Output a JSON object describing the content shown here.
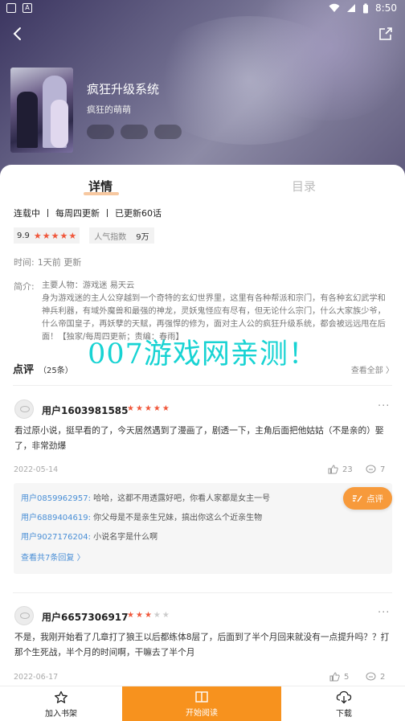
{
  "status_bar": {
    "time": "8:50"
  },
  "book": {
    "title": "疯狂升级系统",
    "author": "疯狂的萌萌",
    "tags": [
      "",
      "",
      ""
    ],
    "status": "连载中",
    "schedule": "每周四更新",
    "updated_count": "已更新60话",
    "score": "9.9",
    "stars": 5,
    "popularity_label": "人气指数",
    "popularity_value": "9万",
    "time_label": "时间:",
    "time_value": "1天前 更新",
    "intro_label": "简介:",
    "intro": "主要人物：游戏迷 易天云\n身为游戏迷的主人公穿越到一个奇特的玄幻世界里，这里有各种帮派和宗门，有各种玄幻武学和神兵利器，有域外魔兽和最强的神龙，灵妖鬼怪应有尽有，但无论什么宗门，什么大家族少爷，什么帝国皇子，再妖孽的天赋，再强悍的修为，面对主人公的疯狂升级系统，都会被远远甩在后面！【独家/每周四更新；责编：春雨】"
  },
  "tabs": {
    "detail": "详情",
    "toc": "目录"
  },
  "watermark": "007游戏网亲测！",
  "reviews": {
    "title": "点评",
    "count": "（25条）",
    "see_all": "查看全部",
    "items": [
      {
        "user": "用户1603981585",
        "stars": 5,
        "text": "看过原小说，挺早看的了，今天居然遇到了漫画了，剧透一下，主角后面把他姑姑（不是亲的）娶了，非常劲爆",
        "date": "2022-05-14",
        "likes": "23",
        "comments": "7",
        "replies": [
          {
            "user": "用户0859962957:",
            "text": " 哈哈，这都不用透露好吧，你看人家都是女主一号"
          },
          {
            "user": "用户6889404619:",
            "text": " 你父母是不是亲生兄妹，搞出你这么个近亲生物"
          },
          {
            "user": "用户9027176204:",
            "text": " 小说名字是什么啊"
          }
        ],
        "more_replies": "查看共7条回复"
      },
      {
        "user": "用户6657306917",
        "stars": 3,
        "text": "不是，我刚开始看了几章打了狼王以后都练体8层了，后面到了半个月回来就没有一点提升吗？？打那个生死战，半个月的时间啊，干嘛去了半个月",
        "date": "2022-06-17",
        "likes": "5",
        "comments": "2"
      }
    ]
  },
  "float_button": "点评",
  "bottom_bar": {
    "shelf": "加入书架",
    "read": "开始阅读",
    "download": "下载"
  },
  "colors": {
    "accent": "#f7921e",
    "star": "#f0573b",
    "link": "#4a8fd6",
    "watermark": "#18d3d3"
  }
}
